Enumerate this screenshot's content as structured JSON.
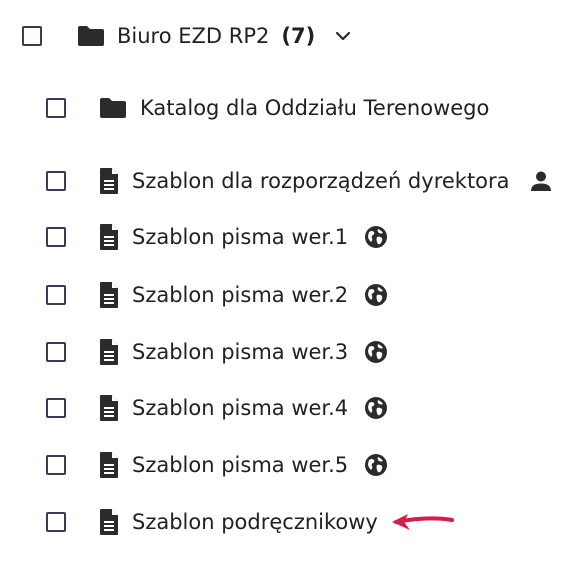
{
  "root": {
    "label": "Biuro EZD RP2",
    "count": "(7)",
    "icon": "folder-icon",
    "expand_icon": "chevron-down-icon"
  },
  "items": [
    {
      "label": "Katalog dla Oddziału Terenowego",
      "icon": "folder-icon",
      "trailing_icon": ""
    },
    {
      "label": "Szablon dla rozporządzeń dyrektora",
      "icon": "document-icon",
      "trailing_icon": "person-icon"
    },
    {
      "label": "Szablon pisma wer.1",
      "icon": "document-icon",
      "trailing_icon": "globe-icon"
    },
    {
      "label": "Szablon pisma wer.2",
      "icon": "document-icon",
      "trailing_icon": "globe-icon"
    },
    {
      "label": "Szablon pisma wer.3",
      "icon": "document-icon",
      "trailing_icon": "globe-icon"
    },
    {
      "label": "Szablon pisma wer.4",
      "icon": "document-icon",
      "trailing_icon": "globe-icon"
    },
    {
      "label": "Szablon pisma wer.5",
      "icon": "document-icon",
      "trailing_icon": "globe-icon"
    },
    {
      "label": "Szablon podręcznikowy",
      "icon": "document-icon",
      "trailing_icon": "arrow-annotation-icon"
    }
  ],
  "colors": {
    "icon": "#2b2b2b",
    "checkbox_border": "#3a3a5a",
    "annotation_arrow": "#d81b4a"
  }
}
